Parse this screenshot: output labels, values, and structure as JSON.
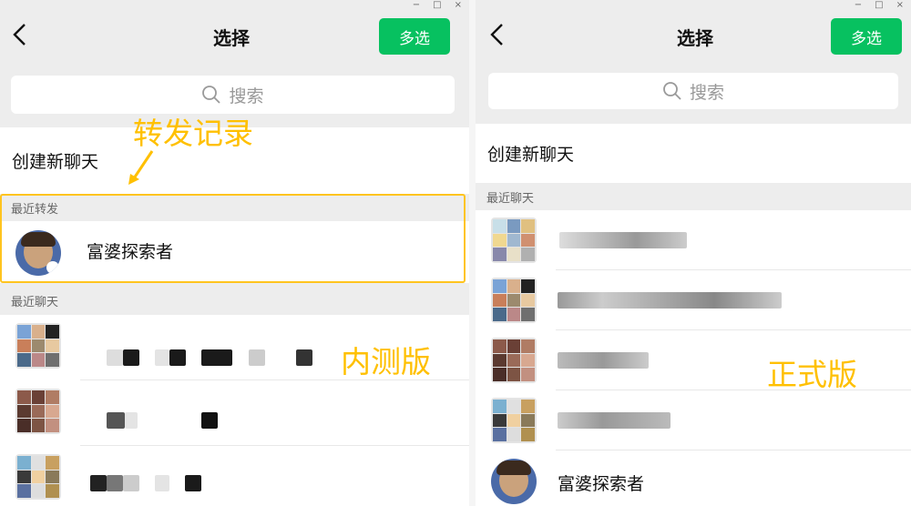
{
  "left": {
    "title": "选择",
    "multi_select": "多选",
    "search_placeholder": "搜索",
    "create_chat": "创建新聊天",
    "recent_forward_header": "最近转发",
    "recent_forward_item": "富婆探索者",
    "recent_chats_header": "最近聊天",
    "annotation_forward": "转发记录",
    "annotation_version": "内测版"
  },
  "right": {
    "title": "选择",
    "multi_select": "多选",
    "search_placeholder": "搜索",
    "create_chat": "创建新聊天",
    "recent_chats_header": "最近聊天",
    "last_item": "富婆探索者",
    "annotation_version": "正式版"
  },
  "window_controls": [
    "−",
    "□",
    "×"
  ],
  "colors": {
    "accent": "#07c160",
    "annotation": "#ffc000",
    "background": "#ededed"
  },
  "icons": [
    "back-arrow-icon",
    "search-icon",
    "minimize-icon",
    "maximize-icon",
    "close-icon",
    "arrow-annotation-icon"
  ]
}
